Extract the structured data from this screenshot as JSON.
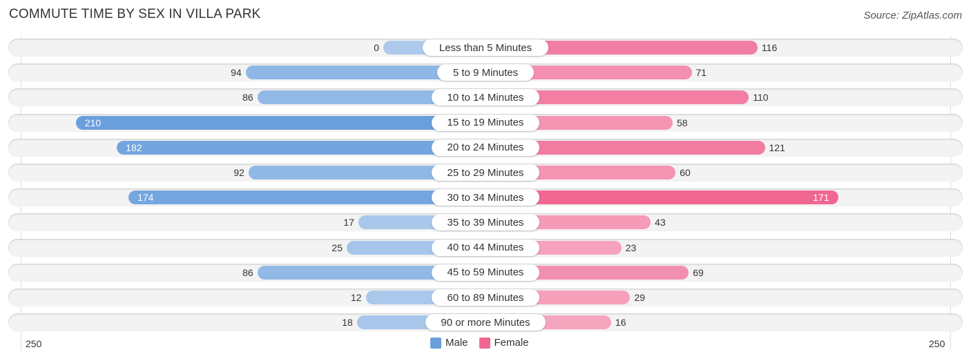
{
  "chart_data": {
    "type": "bar",
    "orientation": "horizontal-diverging",
    "title": "COMMUTE TIME BY SEX IN VILLA PARK",
    "source": "Source: ZipAtlas.com",
    "categories": [
      "Less than 5 Minutes",
      "5 to 9 Minutes",
      "10 to 14 Minutes",
      "15 to 19 Minutes",
      "20 to 24 Minutes",
      "25 to 29 Minutes",
      "30 to 34 Minutes",
      "35 to 39 Minutes",
      "40 to 44 Minutes",
      "45 to 59 Minutes",
      "60 to 89 Minutes",
      "90 or more Minutes"
    ],
    "series": [
      {
        "name": "Male",
        "color": "#6a9fdc",
        "values": [
          0,
          94,
          86,
          210,
          182,
          92,
          174,
          17,
          25,
          86,
          12,
          18
        ]
      },
      {
        "name": "Female",
        "color": "#f06792",
        "values": [
          116,
          71,
          110,
          58,
          121,
          60,
          171,
          43,
          23,
          69,
          29,
          16
        ]
      }
    ],
    "axis": {
      "left_label": "250",
      "right_label": "250",
      "max": 250
    },
    "legend": {
      "position": "bottom-center",
      "items": [
        "Male",
        "Female"
      ]
    }
  }
}
